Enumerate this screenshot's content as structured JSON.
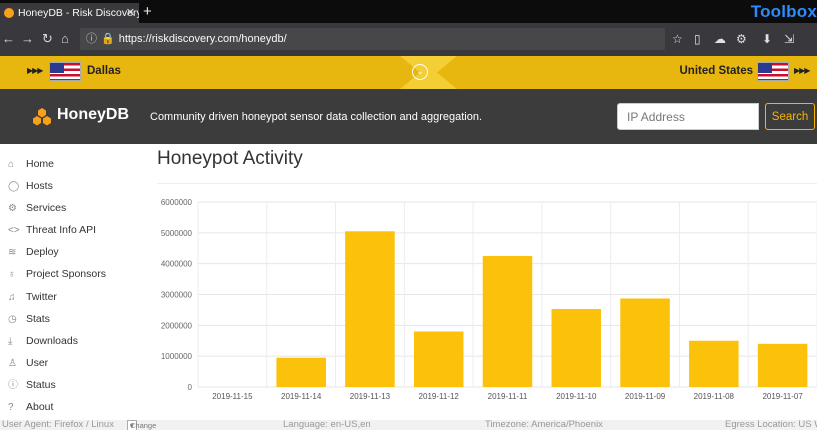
{
  "browser": {
    "tab_title": "HoneyDB - Risk Discovery",
    "url_prefix": "https://",
    "url_host": "riskdiscovery.com",
    "url_path": "/honeydb/",
    "toolbox_label": "Toolbox"
  },
  "location": {
    "city": "Dallas",
    "country": "United States"
  },
  "header": {
    "brand": "HoneyDB",
    "tagline": "Community driven honeypot sensor data collection and aggregation.",
    "search_placeholder": "IP Address",
    "search_button": "Search"
  },
  "sidebar": {
    "items": [
      {
        "label": "Home",
        "icon": "home-icon"
      },
      {
        "label": "Hosts",
        "icon": "hosts-icon"
      },
      {
        "label": "Services",
        "icon": "services-icon"
      },
      {
        "label": "Threat Info API",
        "icon": "code-icon"
      },
      {
        "label": "Deploy",
        "icon": "stack-icon"
      },
      {
        "label": "Project Sponsors",
        "icon": "award-icon"
      },
      {
        "label": "Twitter",
        "icon": "twitter-icon"
      },
      {
        "label": "Stats",
        "icon": "clock-icon"
      },
      {
        "label": "Downloads",
        "icon": "download-icon"
      },
      {
        "label": "User",
        "icon": "user-icon"
      },
      {
        "label": "Status",
        "icon": "status-icon"
      },
      {
        "label": "About",
        "icon": "info-icon"
      }
    ]
  },
  "main": {
    "title": "Honeypot Activity"
  },
  "status": {
    "user_agent": "User Agent:  Firefox / Linux",
    "ua_select": "Change",
    "language": "Language:  en-US,en",
    "timezone": "Timezone:  America/Phoenix",
    "egress": "Egress Location:  US West"
  },
  "colors": {
    "bar": "#fbc10b",
    "header_bg": "#3c3c3c",
    "accent": "#f7b500"
  },
  "chart_data": {
    "type": "bar",
    "categories": [
      "2019-11-15",
      "2019-11-14",
      "2019-11-13",
      "2019-11-12",
      "2019-11-11",
      "2019-11-10",
      "2019-11-09",
      "2019-11-08",
      "2019-11-07"
    ],
    "values": [
      0,
      950000,
      5050000,
      1800000,
      4250000,
      2530000,
      2870000,
      1500000,
      1400000
    ],
    "yticks": [
      0,
      1000000,
      2000000,
      3000000,
      4000000,
      5000000,
      6000000
    ],
    "ylim": [
      0,
      6000000
    ],
    "title": "",
    "xlabel": "",
    "ylabel": "",
    "grid": true
  }
}
